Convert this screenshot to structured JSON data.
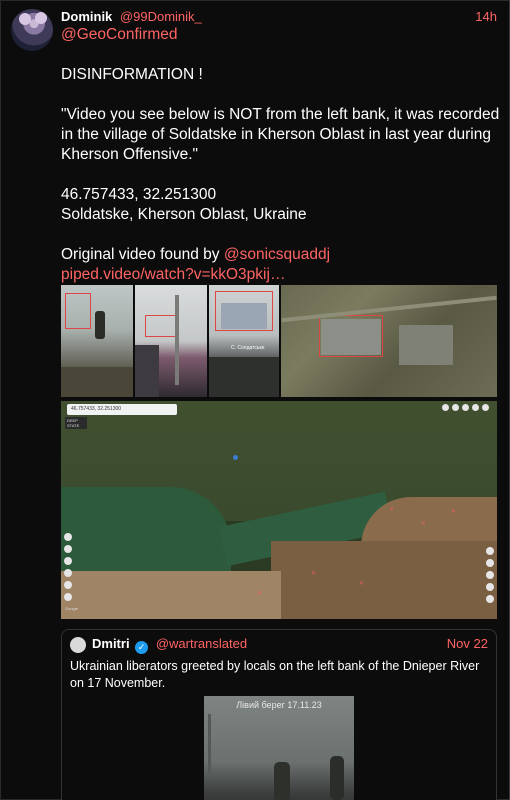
{
  "post": {
    "author": {
      "display_name": "Dominik",
      "handle": "@99Dominik_",
      "avatar_icon": "cartoon-cat-avatar"
    },
    "time": "14h",
    "body": {
      "mention": "@GeoConfirmed",
      "headline": "DISINFORMATION !",
      "quote": "\"Video you see below is NOT from the left bank, it was recorded in the village of Soldatske in Kherson Oblast in last year during Kherson Offensive.\"",
      "coordinates": "46.757433, 32.251300",
      "location": "Soldatske, Kherson Oblast, Ukraine",
      "source_prefix": "Original video found by ",
      "source_mention": "@sonicsquaddj",
      "source_link": "piped.video/watch?v=kkO3pkij…"
    },
    "media": {
      "thumb3_caption": "С. Солдатське",
      "map_search_text": "46.757433, 32.251300",
      "map_logo_text": "DEEP STATE",
      "map_scale": "Google"
    }
  },
  "quoted_post": {
    "author": {
      "display_name": "Dmitri",
      "handle": "@wartranslated",
      "verified_icon": "verified-check-icon"
    },
    "time": "Nov 22",
    "text": "Ukrainian liberators greeted by locals on the left bank of the Dnieper River on 17 November.",
    "video_overlay": "Лівий берег 17.11.23"
  },
  "colors": {
    "accent": "#ff6464",
    "background": "#0c0c0c",
    "border": "#2a2a2a"
  }
}
